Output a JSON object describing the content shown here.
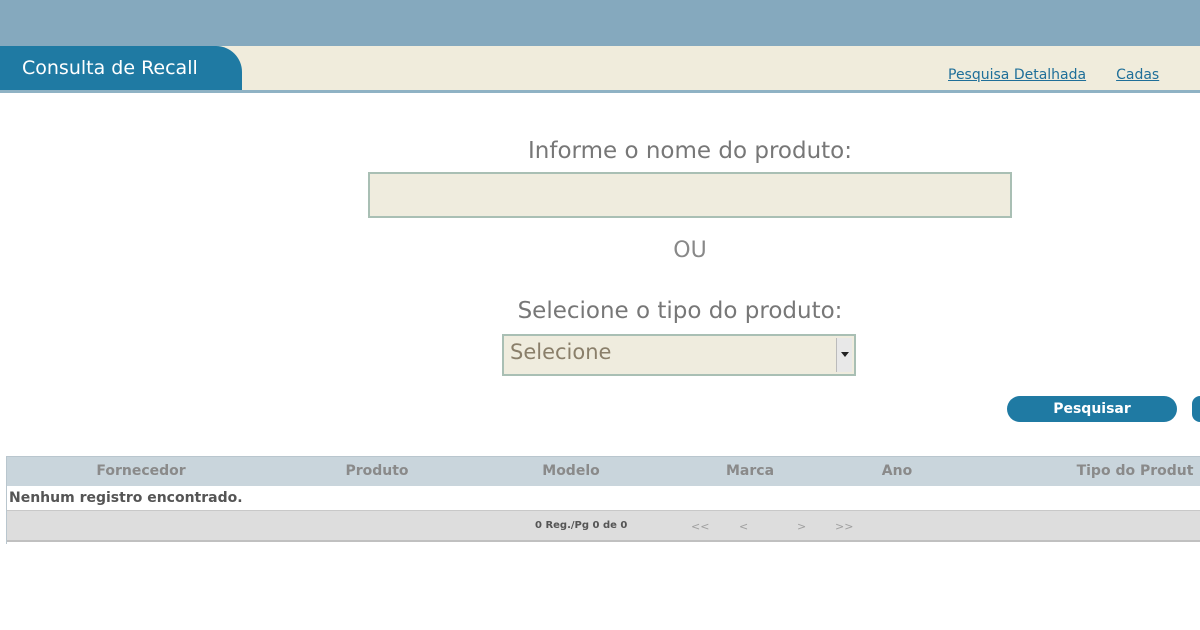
{
  "header": {
    "active_tab": "Consulta de Recall",
    "links": [
      "Pesquisa Detalhada",
      "Cadas"
    ]
  },
  "form": {
    "name_label": "Informe o nome do produto:",
    "name_value": "",
    "or_label": "OU",
    "type_label": "Selecione o tipo do produto:",
    "type_selected": "Selecione",
    "search_button": "Pesquisar"
  },
  "table": {
    "columns": [
      "Fornecedor",
      "Produto",
      "Modelo",
      "Marca",
      "Ano",
      "Tipo do Produt"
    ],
    "empty_message": "Nenhum registro encontrado.",
    "pager": {
      "info": "0 Reg./Pg 0 de 0",
      "first": "<<",
      "prev": "<",
      "next": ">",
      "last": ">>"
    }
  },
  "colors": {
    "brand_blue": "#1f7aa3",
    "top_bar": "#85a9be",
    "field_bg": "#efecde",
    "header_row_bg": "#c9d5dc"
  }
}
